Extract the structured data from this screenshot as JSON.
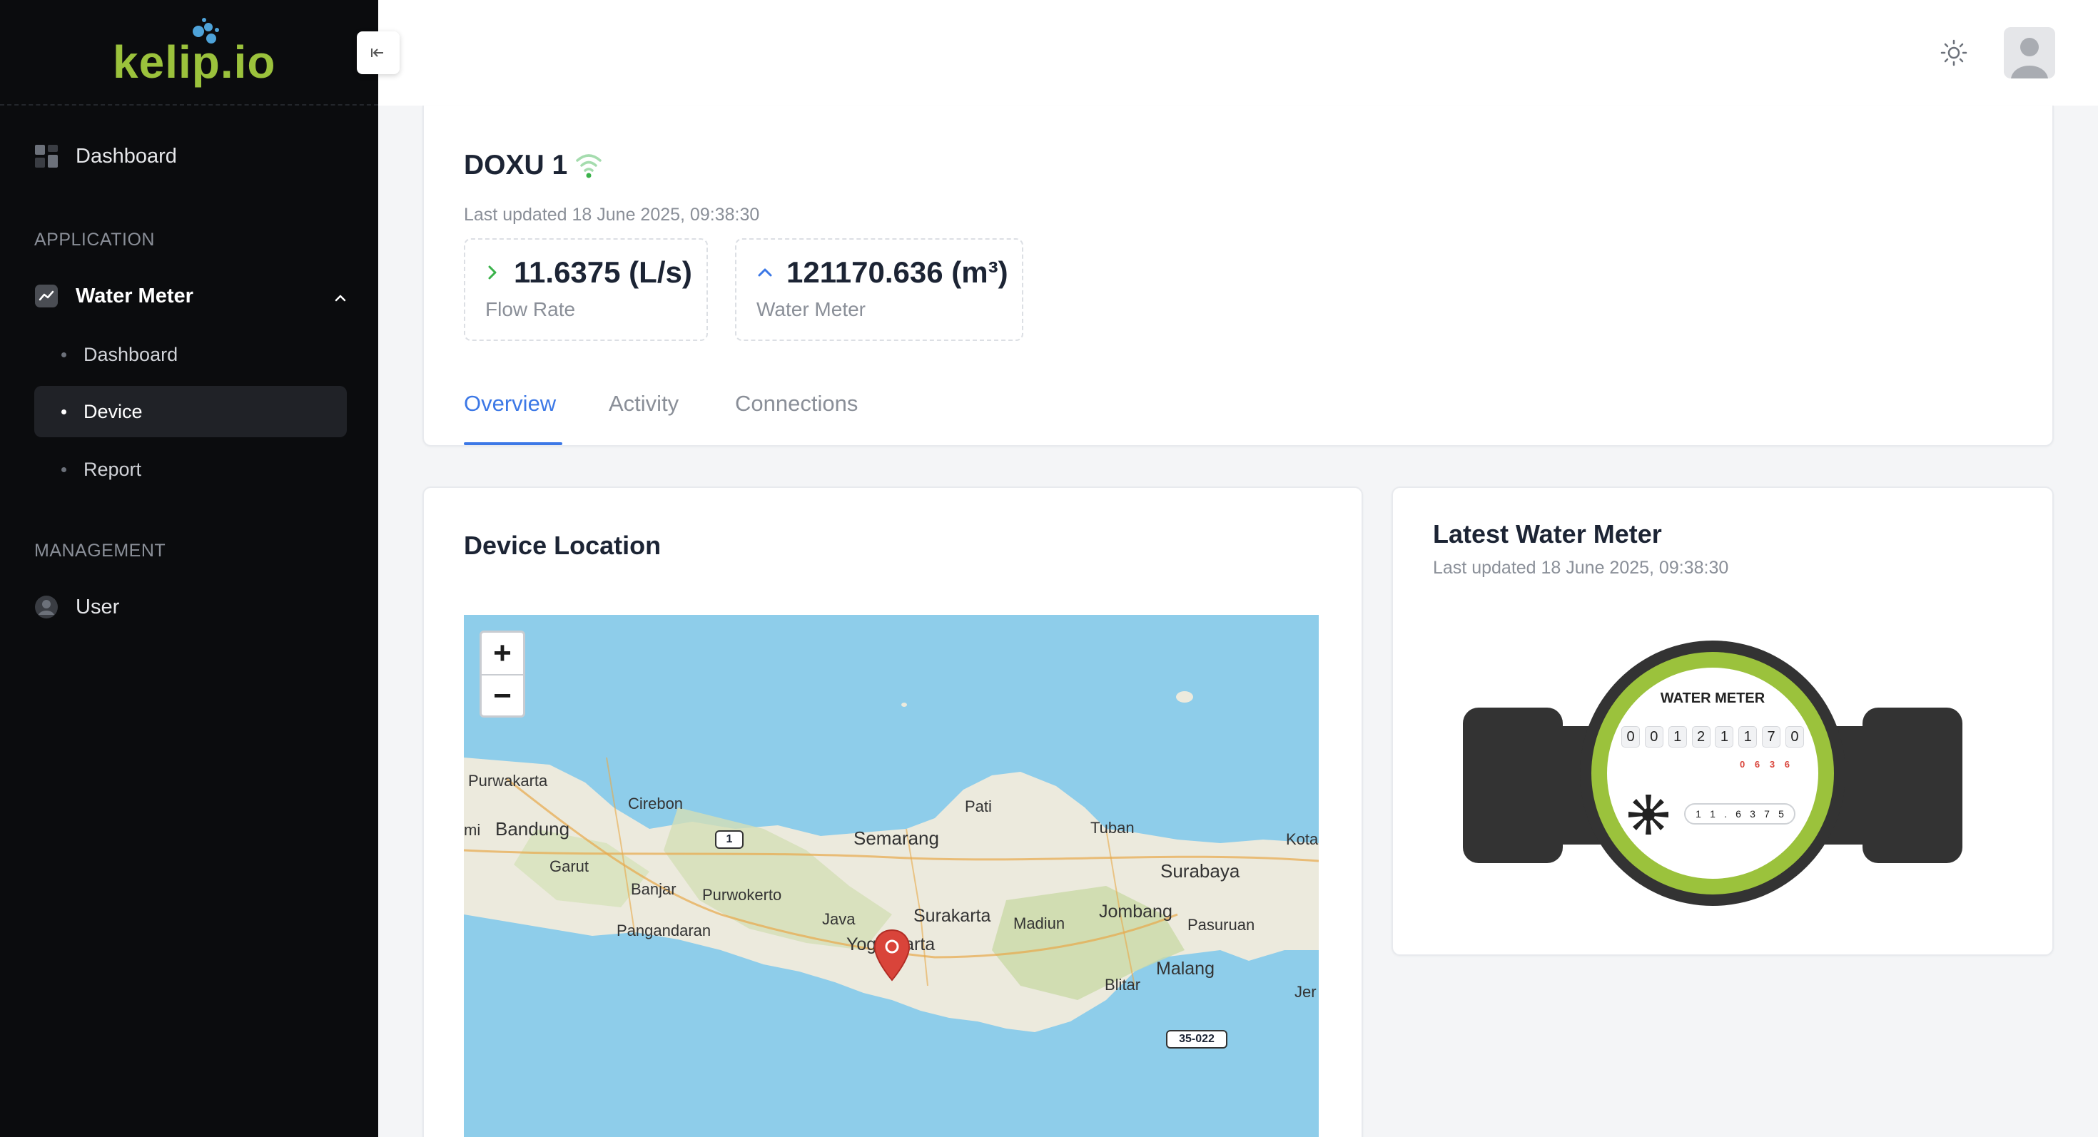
{
  "brand": {
    "name": "kelip.io"
  },
  "sidebar": {
    "dashboard_label": "Dashboard",
    "section_application": "APPLICATION",
    "water_meter_label": "Water Meter",
    "sub_items": [
      {
        "label": "Dashboard",
        "active": false
      },
      {
        "label": "Device",
        "active": true
      },
      {
        "label": "Report",
        "active": false
      }
    ],
    "section_management": "MANAGEMENT",
    "user_label": "User"
  },
  "device": {
    "name": "DOXU 1",
    "last_updated": "Last updated 18 June 2025, 09:38:30",
    "stats": [
      {
        "value": "11.6375 (L/s)",
        "label": "Flow Rate",
        "arrow": "right",
        "color": "#3ab24a"
      },
      {
        "value": "121170.636 (m³)",
        "label": "Water Meter",
        "arrow": "up",
        "color": "#3c78e6"
      }
    ]
  },
  "tabs": [
    {
      "label": "Overview",
      "active": true
    },
    {
      "label": "Activity",
      "active": false
    },
    {
      "label": "Connections",
      "active": false
    }
  ],
  "location": {
    "title": "Device Location",
    "zoom_in": "+",
    "zoom_out": "−",
    "places": [
      "Purwakarta",
      "Cirebon",
      "Bandung",
      "mi",
      "Garut",
      "Banjar",
      "Purwokerto",
      "Pangandaran",
      "Semarang",
      "Pati",
      "Tuban",
      "Kota",
      "Surabaya",
      "Surakarta",
      "Java",
      "Madiun",
      "Jombang",
      "Pasuruan",
      "Yogyakarta",
      "Malang",
      "Blitar",
      "Jer"
    ],
    "road_labels": [
      "1",
      "35-022"
    ]
  },
  "latest_meter": {
    "title": "Latest Water Meter",
    "last_updated": "Last updated 18 June 2025, 09:38:30",
    "dial_title": "WATER METER",
    "main_digits": [
      "0",
      "0",
      "1",
      "2",
      "1",
      "1",
      "7",
      "0"
    ],
    "decimal_digits": [
      "0",
      "6",
      "3",
      "6"
    ],
    "flow_digits": [
      "1",
      "1",
      ".",
      "6",
      "3",
      "7",
      "5"
    ]
  },
  "colors": {
    "accent": "#3c78e6",
    "brand": "#9bc23c",
    "sidebar_bg": "#0b0c0e",
    "meter_ring": "#9bc23c"
  },
  "icons": {
    "collapse": "arrow-left-icon",
    "theme": "sun-icon",
    "wifi": "wifi-icon"
  }
}
